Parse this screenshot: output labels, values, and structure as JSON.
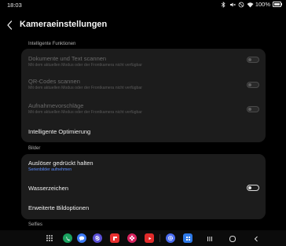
{
  "status_bar": {
    "time": "18:03",
    "battery_text": "100%",
    "battery_level": 1.0
  },
  "header": {
    "title": "Kameraeinstellungen"
  },
  "sections": {
    "smart_features_label": "Intelligente Funktionen",
    "images_label": "Bilder",
    "selfies_label": "Selfies"
  },
  "smart_features": {
    "scan_docs": {
      "title": "Dokumente und Text scannen",
      "subtitle": "Mit dem aktuellen Modus oder der Frontkamera nicht verfügbar",
      "enabled": false
    },
    "qr_codes": {
      "title": "QR-Codes scannen",
      "subtitle": "Mit dem aktuellen Modus oder der Frontkamera nicht verfügbar",
      "enabled": false
    },
    "shot_suggestions": {
      "title": "Aufnahmevorschläge",
      "subtitle": "Mit dem aktuellen Modus oder der Frontkamera nicht verfügbar",
      "enabled": false
    },
    "intelligent_optimization": {
      "title": "Intelligente Optimierung"
    }
  },
  "images": {
    "hold_shutter": {
      "title": "Auslöser gedrückt halten",
      "subtitle": "Serienbilder aufnehmen"
    },
    "watermark": {
      "title": "Wasserzeichen",
      "enabled": false
    },
    "advanced_options": {
      "title": "Erweiterte Bildoptionen"
    }
  },
  "taskbar": {
    "apps": [
      {
        "icon": "phone-icon",
        "color": "#1aa260"
      },
      {
        "icon": "messages-icon",
        "color": "#3d7bf5"
      },
      {
        "icon": "samsung-internet-icon",
        "color": "#5a4fd6"
      },
      {
        "icon": "flipboard-icon",
        "color": "#e8302f"
      },
      {
        "icon": "flower-icon",
        "color": "#d9245f"
      },
      {
        "icon": "youtube-icon",
        "color": "#e02a2a"
      },
      {
        "icon": "settings-icon",
        "color": "#4a6cf0"
      },
      {
        "icon": "calculator-icon",
        "color": "#2d79e8"
      }
    ]
  },
  "colors": {
    "background": "#000000",
    "card": "#1c1c1c",
    "link": "#5b8cff"
  }
}
